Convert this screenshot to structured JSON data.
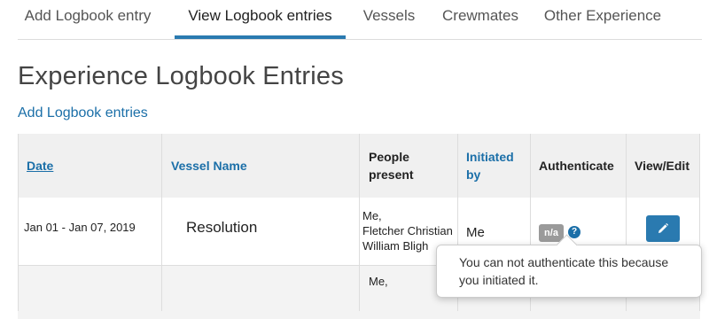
{
  "tabs": [
    {
      "label": "Add Logbook entry",
      "active": false
    },
    {
      "label": "View Logbook entries",
      "active": true
    },
    {
      "label": "Vessels",
      "active": false
    },
    {
      "label": "Crewmates",
      "active": false
    },
    {
      "label": "Other Experience",
      "active": false
    }
  ],
  "page_title": "Experience Logbook Entries",
  "add_link": "Add Logbook entries",
  "table": {
    "columns": [
      {
        "label": "Date",
        "sortable": true
      },
      {
        "label": "Vessel Name",
        "sortable": true
      },
      {
        "label": "People present",
        "sortable": false
      },
      {
        "label": "Initiated by",
        "sortable": true
      },
      {
        "label": "Authenticate",
        "sortable": false
      },
      {
        "label": "View/Edit",
        "sortable": false
      }
    ],
    "rows": [
      {
        "date": "Jan 01 - Jan 07, 2019",
        "vessel": "Resolution",
        "people": [
          "Me,",
          "Fletcher Christian",
          "William Bligh"
        ],
        "initiated_by": "Me",
        "authenticate_badge": "n/a",
        "help_icon": "question-circle-icon",
        "edit_icon": "pencil-icon"
      },
      {
        "people_partial": "Me,"
      }
    ]
  },
  "tooltip": {
    "text": "You can not authenticate this because you initiated it."
  },
  "colors": {
    "link": "#1b6fa8",
    "active_tab_underline": "#2a7ab0",
    "edit_button": "#2a7ab0",
    "badge": "#9a9a9a",
    "header_bg": "#f0f0f0"
  }
}
